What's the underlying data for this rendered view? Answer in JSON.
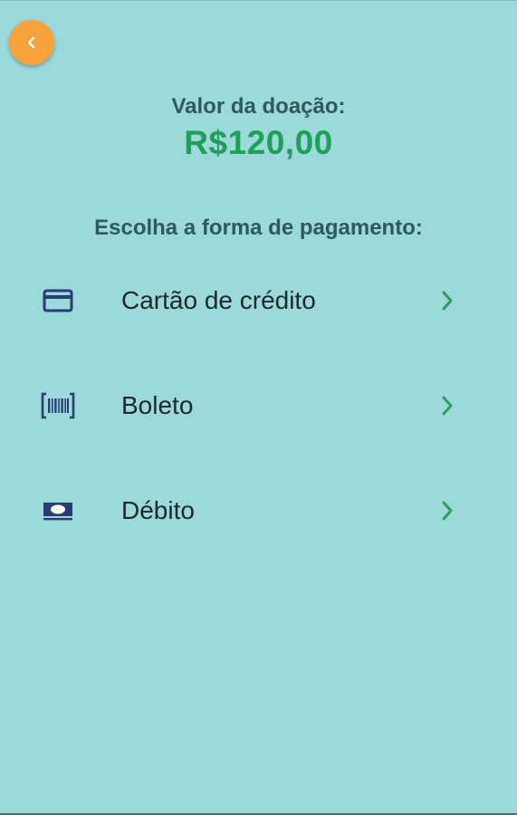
{
  "colors": {
    "background": "#9bd9da",
    "back_button": "#f7a23b",
    "heading_text": "#2e5a5b",
    "amount_green": "#1f9f57",
    "icon_navy": "#283e72",
    "chevron_green": "#2aa15a"
  },
  "header": {
    "back_icon": "chevron-left-icon"
  },
  "donation": {
    "label": "Valor da doação:",
    "amount": "R$120,00"
  },
  "payment": {
    "prompt": "Escolha a forma de pagamento:",
    "options": [
      {
        "label": "Cartão de crédito",
        "icon": "credit-card-icon"
      },
      {
        "label": "Boleto",
        "icon": "barcode-icon"
      },
      {
        "label": "Débito",
        "icon": "cash-icon"
      }
    ],
    "chevron_icon": "chevron-right-icon"
  }
}
